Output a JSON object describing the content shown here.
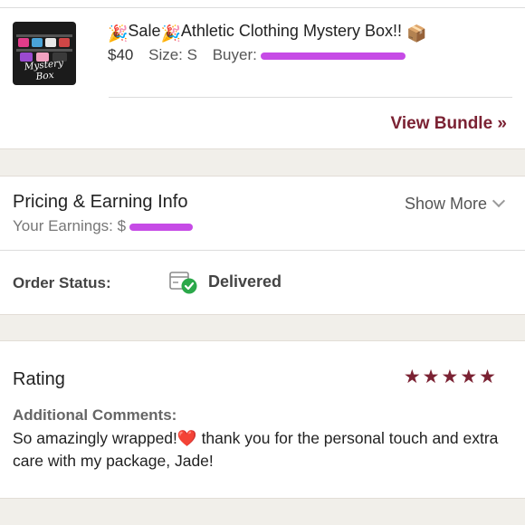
{
  "item": {
    "thumbnail_text": "Mystery Box",
    "title_emoji_left": "🎉",
    "title_word_sale": "Sale",
    "title_emoji_mid": "🎉",
    "title_text": "Athletic Clothing Mystery Box!!",
    "title_emoji_right": "📦",
    "price": "$40",
    "size_label": "Size: S",
    "buyer_label": "Buyer:",
    "view_bundle": "View Bundle »"
  },
  "pricing": {
    "title": "Pricing & Earning Info",
    "show_more": "Show More",
    "earnings_label": "Your Earnings:",
    "earnings_prefix": "$"
  },
  "order_status": {
    "label": "Order Status:",
    "value": "Delivered",
    "icon": "delivered-box-icon"
  },
  "rating": {
    "title": "Rating",
    "stars": "★★★★★",
    "star_count": 5,
    "comments_label": "Additional Comments:",
    "comment_before": "So amazingly wrapped!",
    "comment_emoji": "❤️",
    "comment_after": " thank you for the personal touch and extra care with my package, Jade!"
  },
  "colors": {
    "accent": "#7b2233",
    "redaction": "#c64be6",
    "check": "#2ba84a",
    "background": "#f1efea"
  }
}
